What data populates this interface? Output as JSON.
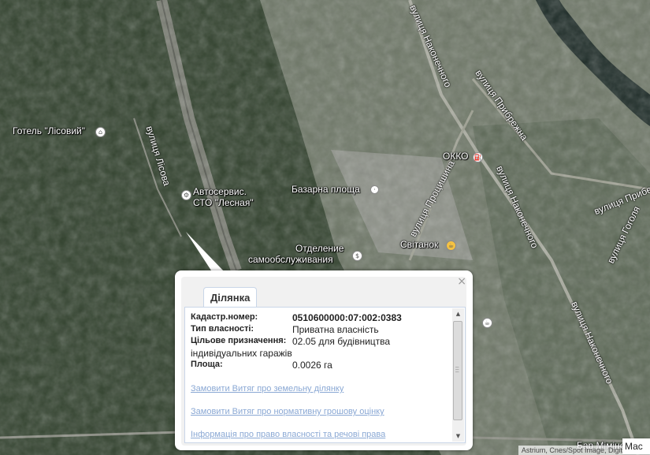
{
  "map": {
    "labels": [
      {
        "name": "hotel-label",
        "text": "Готель \"Лісовий\""
      },
      {
        "name": "autoservice-label-1",
        "text": "Автосервис."
      },
      {
        "name": "autoservice-label-2",
        "text": "СТО \"Лесная\""
      },
      {
        "name": "bazaar-label",
        "text": "Базарна площа"
      },
      {
        "name": "okko-label",
        "text": "ОККО"
      },
      {
        "name": "otdelenie-label-1",
        "text": "Отделение"
      },
      {
        "name": "otdelenie-label-2",
        "text": "самообслуживания"
      },
      {
        "name": "svitanok-label",
        "text": "Світанок"
      },
      {
        "name": "bar-label",
        "text": "Бар Міміно"
      }
    ],
    "streets": [
      {
        "name": "street-lisova",
        "text": "вулиця Лісова"
      },
      {
        "name": "street-nakonechnoho-top",
        "text": "вулиця Наконечного"
      },
      {
        "name": "street-prybrezhna",
        "text": "вулиця Прибрежна"
      },
      {
        "name": "street-protsyshyna",
        "text": "вулиця Процишина"
      },
      {
        "name": "street-nakonechnoho-mid",
        "text": "вулиця Наконечного"
      },
      {
        "name": "street-nakonechnoho-bottom",
        "text": "вулиця Наконечного"
      },
      {
        "name": "street-prybere-right",
        "text": "вулиця Прибере"
      },
      {
        "name": "street-hoholia",
        "text": "вулиця Гоголя"
      }
    ],
    "attribution": "Astrium, Cnes/Spot Image, DigitalGlobe",
    "scale_button": "Мас"
  },
  "popup": {
    "tab_label": "Ділянка",
    "close_glyph": "×",
    "rows": [
      {
        "key": "Кадастр.номер:",
        "value": "0510600000:07:002:0383"
      },
      {
        "key": "Тип власності:",
        "value": "Приватна власність"
      },
      {
        "key": "Цільове призначення:",
        "value": "02.05 для будівництва"
      },
      {
        "key": "",
        "value": "індивідуальних гаражів"
      },
      {
        "key": "Площа:",
        "value": "0.0026 га"
      }
    ],
    "links": [
      "Замовити Витяг про земельну ділянку",
      "Замовити Витяг про нормативну грошову оцінку",
      "Інформація про право власності та речові права"
    ]
  },
  "colors": {
    "forest": "#2e3e2a",
    "urban": "#6a7464",
    "river": "#1c2a26",
    "link": "#8aa8d4"
  },
  "icons": {
    "hotel": "hotel-icon",
    "autoservice": "car-service-icon",
    "okko": "fuel-icon",
    "bank": "bank-icon",
    "restaurant": "restaurant-icon",
    "bazaar": "market-icon"
  }
}
